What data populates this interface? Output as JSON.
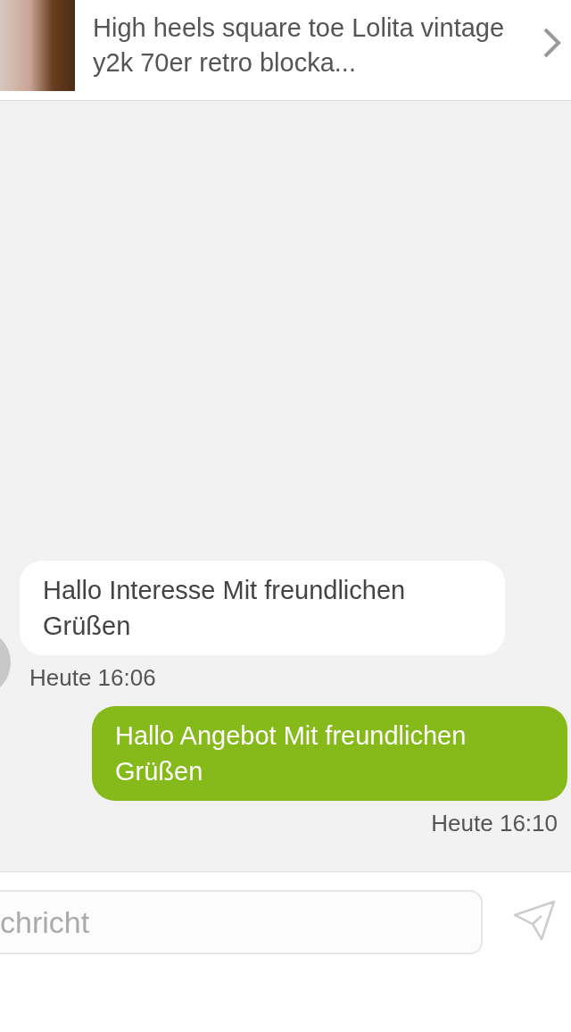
{
  "listing": {
    "title": "High heels square toe Lolita vintage y2k 70er retro blocka..."
  },
  "messages": [
    {
      "kind": "received",
      "text": "Hallo Interesse Mit freundlichen Grüßen",
      "time": "Heute 16:06"
    },
    {
      "kind": "sent",
      "text": "Hallo Angebot Mit freundlichen Grüßen",
      "time": "Heute 16:10"
    }
  ],
  "composer": {
    "placeholder": "chricht"
  }
}
